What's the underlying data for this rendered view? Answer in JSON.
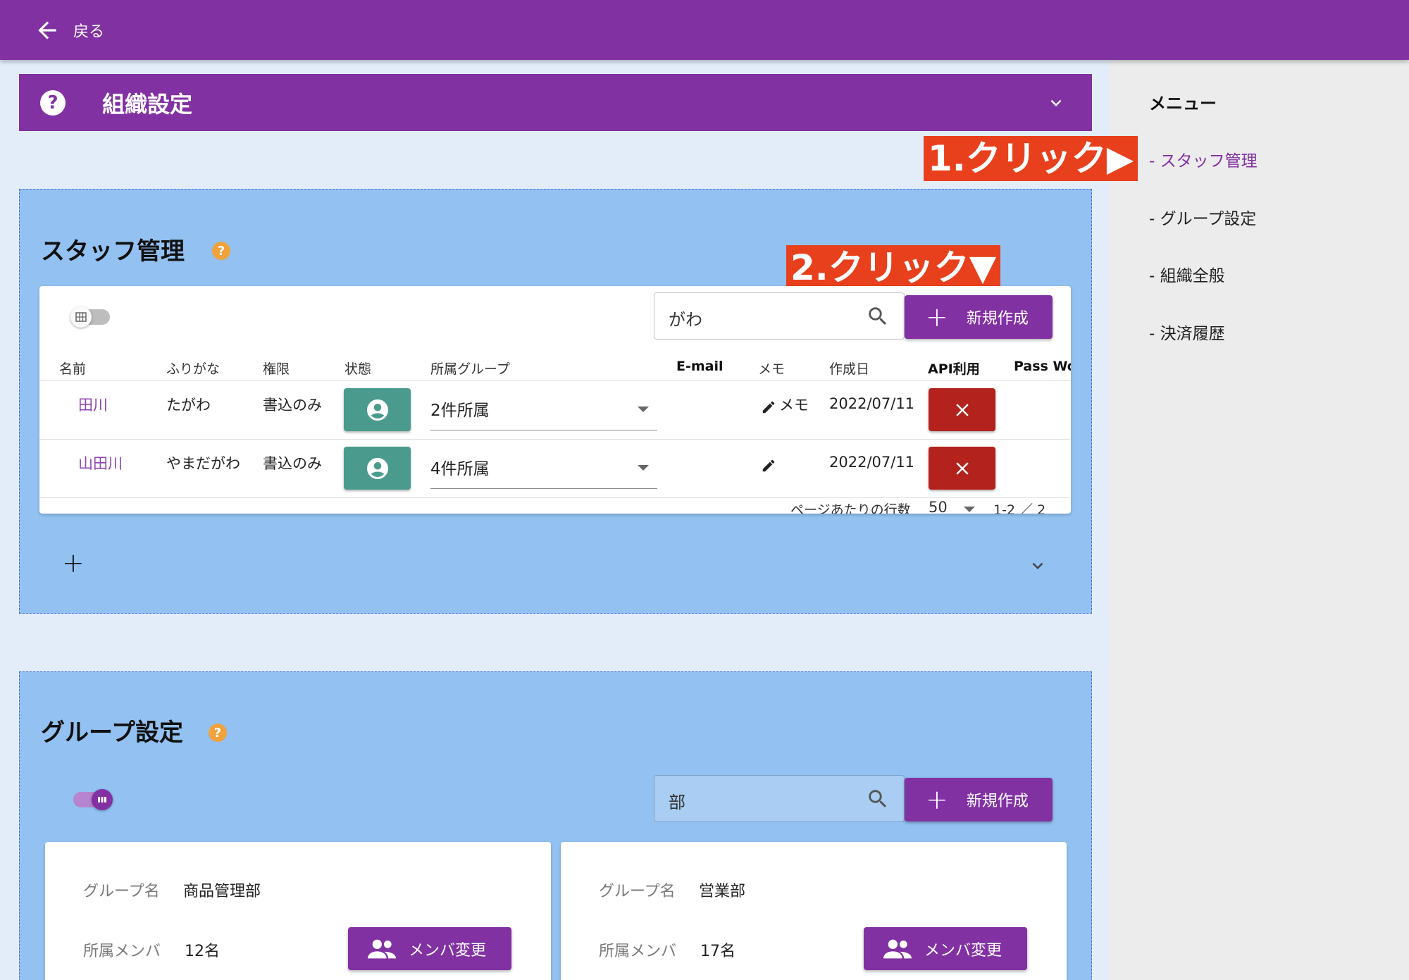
{
  "topbar": {
    "back_label": "戻る"
  },
  "org_header": {
    "title": "組織設定",
    "help": "?"
  },
  "menu": {
    "title": "メニュー",
    "items": [
      {
        "label": "- スタッフ管理",
        "active": true
      },
      {
        "label": "- グループ設定",
        "active": false
      },
      {
        "label": "- 組織全般",
        "active": false
      },
      {
        "label": "- 決済履歴",
        "active": false
      }
    ]
  },
  "annotations": {
    "step1": "1.クリック▶",
    "step2": "2.クリック▼"
  },
  "staff": {
    "title": "スタッフ管理",
    "help": "?",
    "search_value": "がわ",
    "new_button": "新規作成",
    "headers": [
      "名前",
      "ふりがな",
      "権限",
      "状態",
      "所属グループ",
      "E-mail",
      "メモ",
      "作成日",
      "API利用",
      "Pass Wo"
    ],
    "rows": [
      {
        "name": "田川",
        "kana": "たがわ",
        "role": "書込のみ",
        "group": "2件所属",
        "memo": "メモ",
        "created": "2022/07/11"
      },
      {
        "name": "山田川",
        "kana": "やまだがわ",
        "role": "書込のみ",
        "group": "4件所属",
        "memo": "",
        "created": "2022/07/11"
      }
    ],
    "pager": {
      "rows_per_page_label": "ページあたりの行数",
      "rows_per_page": "50",
      "range": "1-2 ／ 2"
    },
    "add_symbol": "+"
  },
  "groups": {
    "title": "グループ設定",
    "help": "?",
    "search_value": "部",
    "new_button": "新規作成",
    "cards": [
      {
        "name_label": "グループ名",
        "name": "商品管理部",
        "members_label": "所属メンバ",
        "members": "12名",
        "button": "メンバ変更"
      },
      {
        "name_label": "グループ名",
        "name": "営業部",
        "members_label": "所属メンバ",
        "members": "17名",
        "button": "メンバ変更"
      }
    ]
  },
  "colors": {
    "primary": "#8231a3",
    "section_bg": "#92c1f2",
    "danger": "#b3221c",
    "status": "#4a9b8e",
    "annotation": "#e8401c"
  }
}
